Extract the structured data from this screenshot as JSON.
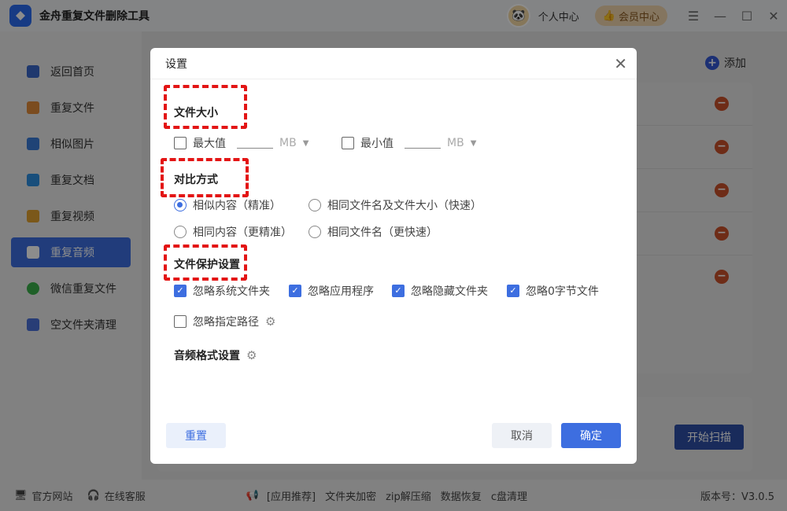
{
  "app": {
    "title": "金舟重复文件删除工具",
    "personal": "个人中心",
    "member": "会员中心"
  },
  "sidebar": {
    "items": [
      {
        "label": "返回首页",
        "color": "#3a66c8"
      },
      {
        "label": "重复文件",
        "color": "#e08a3a"
      },
      {
        "label": "相似图片",
        "color": "#3a7ad8"
      },
      {
        "label": "重复文档",
        "color": "#2d8fe0"
      },
      {
        "label": "重复视频",
        "color": "#e0a030"
      },
      {
        "label": "重复音频",
        "color": "#ffffff"
      },
      {
        "label": "微信重复文件",
        "color": "#3ab04a"
      },
      {
        "label": "空文件夹清理",
        "color": "#4a6fd8"
      }
    ]
  },
  "main": {
    "add_label": "添加",
    "scan_label": "开始扫描",
    "minus": "−"
  },
  "footer": {
    "site": "官方网站",
    "service": "在线客服",
    "recommend": "[应用推荐]",
    "links": [
      "文件夹加密",
      "zip解压缩",
      "数据恢复",
      "c盘清理"
    ],
    "version": "版本号：V3.0.5"
  },
  "dialog": {
    "title": "设置",
    "size_section": "文件大小",
    "max_label": "最大值",
    "min_label": "最小值",
    "unit": "MB",
    "compare_section": "对比方式",
    "compare_options": [
      "相似内容（精准）",
      "相同文件名及文件大小（快速）",
      "相同内容（更精准）",
      "相同文件名（更快速）"
    ],
    "protect_section": "文件保护设置",
    "protect_options": [
      "忽略系统文件夹",
      "忽略应用程序",
      "忽略隐藏文件夹",
      "忽略0字节文件"
    ],
    "ignore_path": "忽略指定路径",
    "audio_section": "音频格式设置",
    "reset": "重置",
    "cancel": "取消",
    "ok": "确定"
  }
}
